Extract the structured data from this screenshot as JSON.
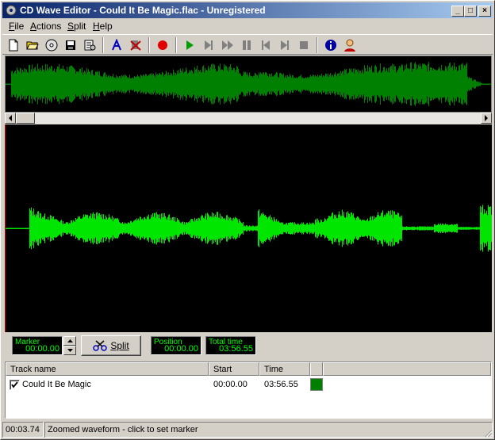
{
  "window": {
    "title": "CD Wave Editor - Could It Be Magic.flac - Unregistered",
    "controls": {
      "minimize": "_",
      "maximize": "□",
      "close": "×"
    }
  },
  "menu": [
    {
      "label": "File",
      "accel": "F",
      "rest": "ile"
    },
    {
      "label": "Actions",
      "accel": "A",
      "rest": "ctions"
    },
    {
      "label": "Split",
      "accel": "S",
      "rest": "plit"
    },
    {
      "label": "Help",
      "accel": "H",
      "rest": "elp"
    }
  ],
  "toolbar": {
    "icons": [
      "new-file-icon",
      "open-folder-icon",
      "cd-icon",
      "save-icon",
      "properties-icon",
      "auto-split-icon",
      "delete-marker-icon",
      "record-icon",
      "play-icon",
      "play-to-marker-icon",
      "fast-forward-icon",
      "pause-icon",
      "previous-marker-icon",
      "next-marker-icon",
      "stop-icon",
      "info-icon",
      "register-icon"
    ]
  },
  "controls": {
    "marker_label": "Marker",
    "marker_value": "00:00.00",
    "split_label": "Split",
    "position_label": "Position",
    "position_value": "00:00.00",
    "total_label": "Total time",
    "total_value": "03:56.55"
  },
  "tracklist": {
    "columns": [
      "Track name",
      "Start",
      "Time"
    ],
    "rows": [
      {
        "name": "Could It Be Magic",
        "start": "00:00.00",
        "time": "03:56.55",
        "checked": true,
        "color": "#007f00"
      }
    ]
  },
  "status": {
    "time": "00:03.74",
    "message": "Zoomed waveform - click to set marker"
  },
  "colors": {
    "overview_wave": "#008000",
    "zoomed_wave": "#00e600",
    "lcd_text": "#00ff00",
    "cursor": "#cc0000"
  }
}
